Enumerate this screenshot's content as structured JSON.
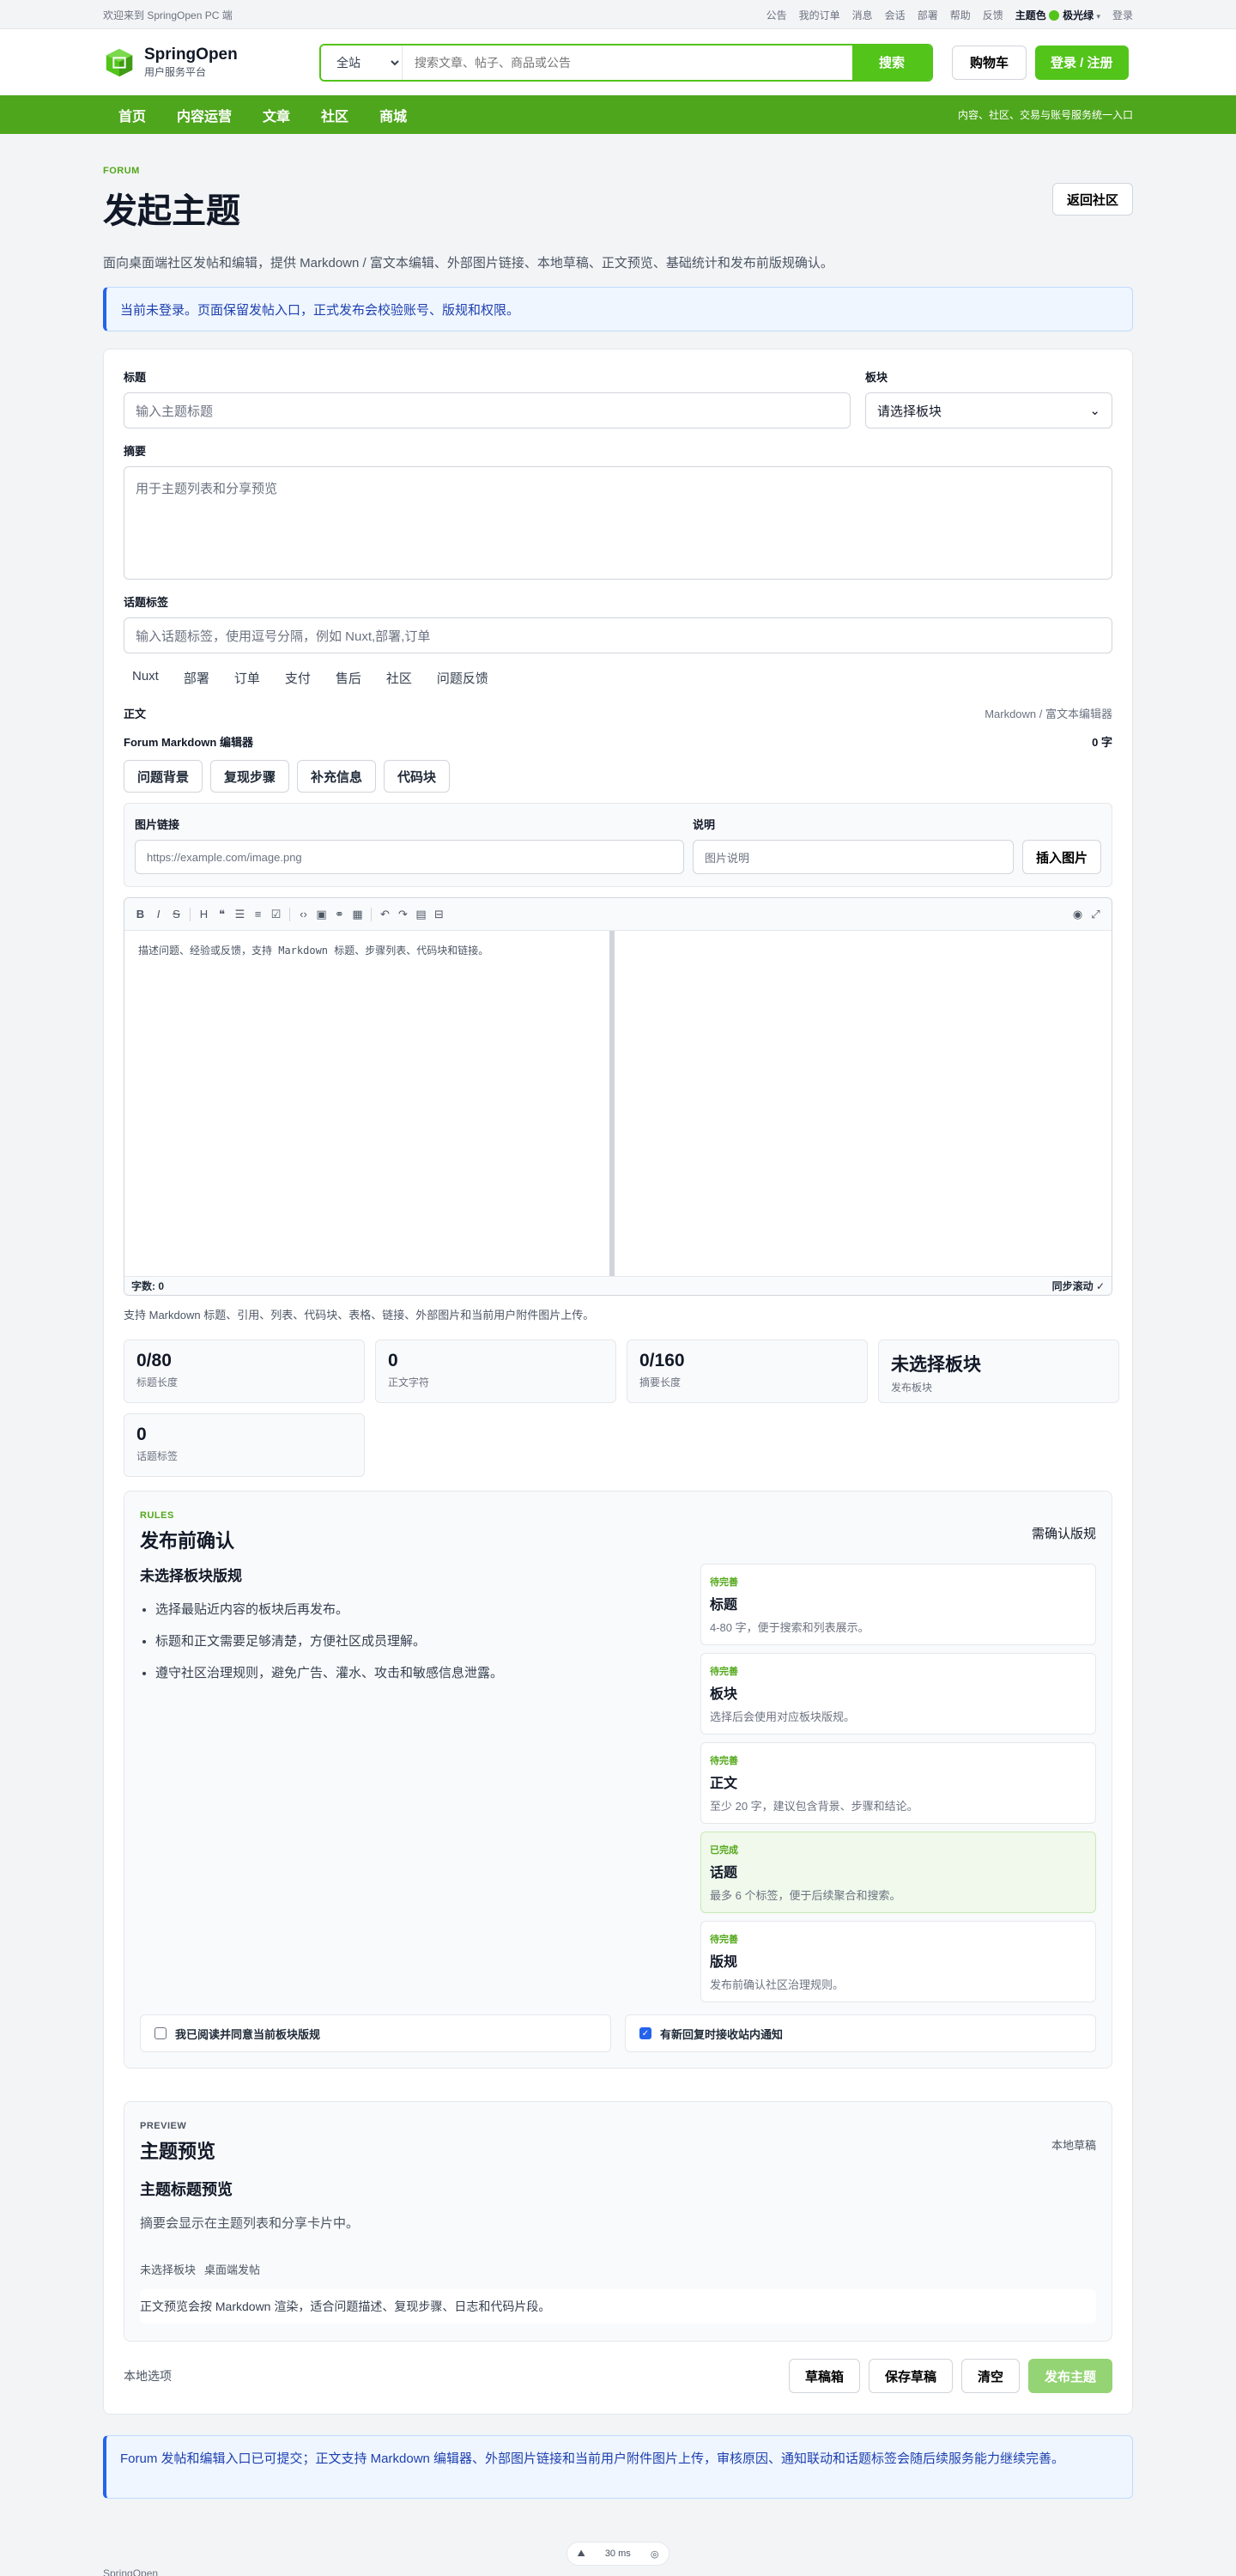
{
  "topbar": {
    "welcome": "欢迎来到 SpringOpen PC 端",
    "links": [
      "公告",
      "我的订单",
      "消息",
      "会话",
      "部署",
      "帮助",
      "反馈"
    ],
    "theme_label": "主题色",
    "theme_value": "极光绿",
    "login": "登录",
    "theme_color": "#52c41a"
  },
  "header": {
    "brand": "SpringOpen",
    "brand_sub": "用户服务平台",
    "search_scope": "全站",
    "search_placeholder": "搜索文章、帖子、商品或公告",
    "search_button": "搜索",
    "cart": "购物车",
    "login_register": "登录 / 注册"
  },
  "nav": {
    "items": [
      "首页",
      "内容运营",
      "文章",
      "社区",
      "商城"
    ],
    "tip": "内容、社区、交易与账号服务统一入口"
  },
  "page": {
    "eyebrow": "FORUM",
    "title": "发起主题",
    "back": "返回社区",
    "desc": "面向桌面端社区发帖和编辑，提供 Markdown / 富文本编辑、外部图片链接、本地草稿、正文预览、基础统计和发布前版规确认。",
    "alert": "当前未登录。页面保留发帖入口，正式发布会校验账号、版规和权限。"
  },
  "form": {
    "title_label": "标题",
    "title_placeholder": "输入主题标题",
    "board_label": "板块",
    "board_placeholder": "请选择板块",
    "summary_label": "摘要",
    "summary_placeholder": "用于主题列表和分享预览",
    "tags_label": "话题标签",
    "tags_placeholder": "输入话题标签，使用逗号分隔，例如 Nuxt,部署,订单",
    "tag_suggestions": [
      "Nuxt",
      "部署",
      "订单",
      "支付",
      "售后",
      "社区",
      "问题反馈"
    ],
    "body_label": "正文",
    "body_mode": "Markdown / 富文本编辑器",
    "editor_name": "Forum Markdown 编辑器",
    "char_count": "0 字",
    "templates": [
      "问题背景",
      "复现步骤",
      "补充信息",
      "代码块"
    ],
    "image_link_label": "图片链接",
    "image_link_placeholder": "https://example.com/image.png",
    "image_desc_label": "说明",
    "image_desc_placeholder": "图片说明",
    "insert_image": "插入图片",
    "editor_placeholder": "描述问题、经验或反馈，支持 Markdown 标题、步骤列表、代码块和链接。",
    "word_count": "字数: 0",
    "sync_scroll": "同步滚动 ✓",
    "hint": "支持 Markdown 标题、引用、列表、代码块、表格、链接、外部图片和当前用户附件图片上传。"
  },
  "stats": [
    {
      "value": "0/80",
      "label": "标题长度"
    },
    {
      "value": "0",
      "label": "正文字符"
    },
    {
      "value": "0/160",
      "label": "摘要长度"
    },
    {
      "value": "未选择板块",
      "label": "发布板块"
    },
    {
      "value": "0",
      "label": "话题标签"
    }
  ],
  "rules": {
    "eyebrow": "RULES",
    "title": "发布前确认",
    "need": "需确认版规",
    "subtitle": "未选择板块版规",
    "items": [
      "选择最贴近内容的板块后再发布。",
      "标题和正文需要足够清楚，方便社区成员理解。",
      "遵守社区治理规则，避免广告、灌水、攻击和敏感信息泄露。"
    ],
    "checks": [
      {
        "status": "待完善",
        "title": "标题",
        "desc": "4-80 字，便于搜索和列表展示。"
      },
      {
        "status": "待完善",
        "title": "板块",
        "desc": "选择后会使用对应板块版规。"
      },
      {
        "status": "待完善",
        "title": "正文",
        "desc": "至少 20 字，建议包含背景、步骤和结论。"
      },
      {
        "status": "已完成",
        "title": "话题",
        "desc": "最多 6 个标签，便于后续聚合和搜索。"
      },
      {
        "status": "待完善",
        "title": "版规",
        "desc": "发布前确认社区治理规则。"
      }
    ],
    "agree_rules": "我已阅读并同意当前板块版规",
    "notify": "有新回复时接收站内通知"
  },
  "preview": {
    "eyebrow": "PREVIEW",
    "title": "主题预览",
    "draft_tag": "本地草稿",
    "heading": "主题标题预览",
    "summary": "摘要会显示在主题列表和分享卡片中。",
    "meta": [
      "未选择板块",
      "桌面端发帖"
    ],
    "body": "正文预览会按 Markdown 渲染，适合问题描述、复现步骤、日志和代码片段。"
  },
  "actions": {
    "local": "本地选项",
    "drafts": "草稿箱",
    "save": "保存草稿",
    "clear": "清空",
    "publish": "发布主题"
  },
  "footer_alert": "Forum 发帖和编辑入口已可提交；正文支持 Markdown 编辑器、外部图片链接和当前用户附件图片上传，审核原因、通知联动和话题标签会随后续服务能力继续完善。",
  "footer_brand": "SpringOpen",
  "perf": "30 ms"
}
